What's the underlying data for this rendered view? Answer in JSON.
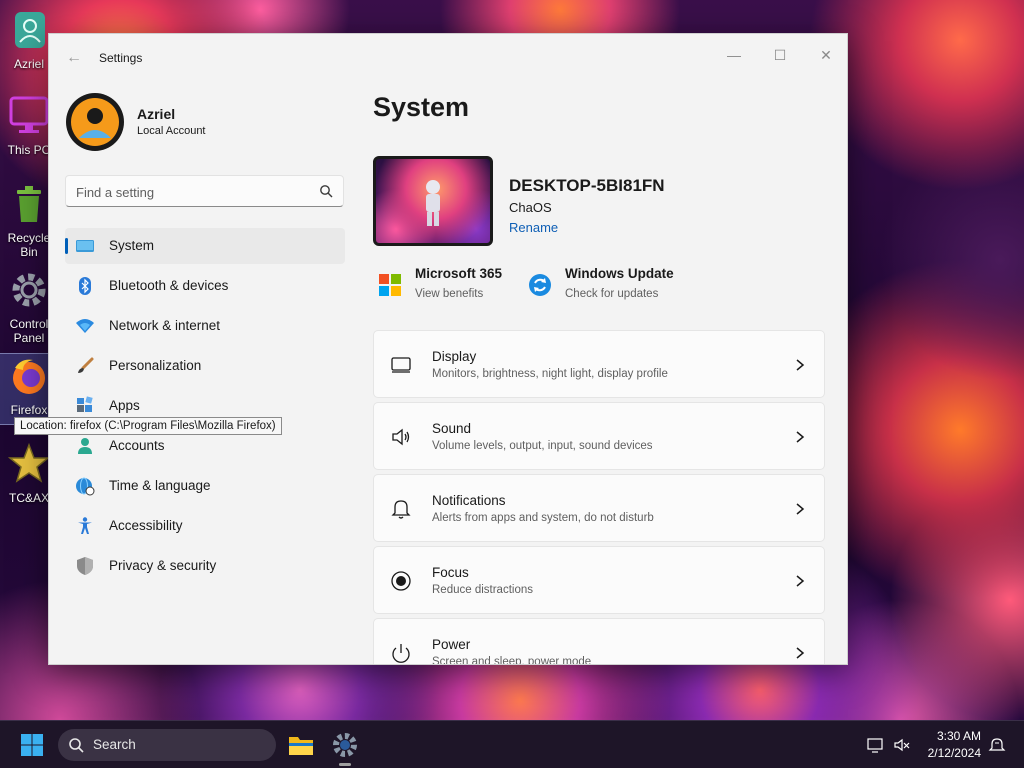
{
  "desktop": {
    "icons": [
      {
        "label": "Azriel"
      },
      {
        "label": "This PC"
      },
      {
        "label": "Recycle Bin"
      },
      {
        "label": "Control Panel"
      },
      {
        "label": "Firefox"
      },
      {
        "label": "TC&AX"
      }
    ],
    "tooltip": "Location: firefox (C:\\Program Files\\Mozilla Firefox)"
  },
  "window": {
    "title": "Settings",
    "controls": {
      "minimize": "—",
      "maximize": "☐",
      "close": "✕"
    }
  },
  "profile": {
    "name": "Azriel",
    "account_type": "Local Account"
  },
  "search": {
    "placeholder": "Find a setting"
  },
  "nav": {
    "items": [
      {
        "label": "System",
        "icon": "system-icon",
        "active": true
      },
      {
        "label": "Bluetooth & devices",
        "icon": "bluetooth-icon"
      },
      {
        "label": "Network & internet",
        "icon": "wifi-icon"
      },
      {
        "label": "Personalization",
        "icon": "brush-icon"
      },
      {
        "label": "Apps",
        "icon": "apps-icon"
      },
      {
        "label": "Accounts",
        "icon": "accounts-icon"
      },
      {
        "label": "Time & language",
        "icon": "globe-clock-icon"
      },
      {
        "label": "Accessibility",
        "icon": "accessibility-icon"
      },
      {
        "label": "Privacy & security",
        "icon": "shield-icon"
      }
    ]
  },
  "main": {
    "title": "System",
    "device": {
      "name": "DESKTOP-5BI81FN",
      "os": "ChaOS",
      "rename": "Rename"
    },
    "quick": [
      {
        "title": "Microsoft 365",
        "subtitle": "View benefits",
        "icon": "microsoft-logo-icon"
      },
      {
        "title": "Windows Update",
        "subtitle": "Check for updates",
        "icon": "windows-update-icon"
      }
    ],
    "cards": [
      {
        "title": "Display",
        "subtitle": "Monitors, brightness, night light, display profile",
        "icon": "display-icon"
      },
      {
        "title": "Sound",
        "subtitle": "Volume levels, output, input, sound devices",
        "icon": "speaker-icon"
      },
      {
        "title": "Notifications",
        "subtitle": "Alerts from apps and system, do not disturb",
        "icon": "bell-icon"
      },
      {
        "title": "Focus",
        "subtitle": "Reduce distractions",
        "icon": "focus-icon"
      },
      {
        "title": "Power",
        "subtitle": "Screen and sleep, power mode",
        "icon": "power-icon"
      }
    ]
  },
  "taskbar": {
    "search_label": "Search",
    "time": "3:30 AM",
    "date": "2/12/2024"
  },
  "colors": {
    "accent": "#005fb8",
    "link": "#0f5fb5",
    "window_bg": "#f3f3f3",
    "taskbar_bg": "#1e1528"
  }
}
